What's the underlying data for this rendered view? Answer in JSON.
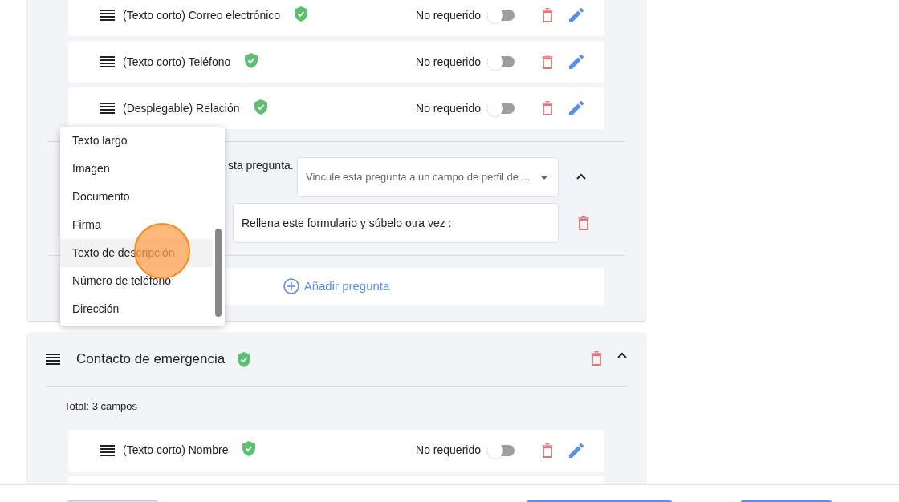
{
  "form_section": {
    "fields": [
      {
        "label": "(Texto corto) Correo electrónico",
        "verified": true,
        "required_label": "No requerido",
        "required": false
      },
      {
        "label": "(Texto corto) Teléfono",
        "verified": true,
        "required_label": "No requerido",
        "required": false
      },
      {
        "label": "(Desplegable) Relación",
        "verified": true,
        "required_label": "No requerido",
        "required": false
      }
    ],
    "question": {
      "label_fragment": "sta pregunta.",
      "link_select": {
        "placeholder": "Vincule esta pregunta a un campo de perfil de ..."
      },
      "expanded": true,
      "description": {
        "value": "Rellena este formulario y súbelo otra vez :"
      }
    },
    "add_button": "Añadir pregunta"
  },
  "type_menu": {
    "items": [
      {
        "label": "Texto largo",
        "selected": false
      },
      {
        "label": "Imagen",
        "selected": false
      },
      {
        "label": "Documento",
        "selected": false
      },
      {
        "label": "Firma",
        "selected": false
      },
      {
        "label": "Texto de descripción",
        "selected": true
      },
      {
        "label": "Número de teléfono",
        "selected": false
      },
      {
        "label": "Dirección",
        "selected": false
      }
    ]
  },
  "section": {
    "title": "Contacto de emergencia",
    "verified": true,
    "expanded": true,
    "total": "Total: 3 campos",
    "fields": [
      {
        "label": "(Texto corto) Nombre",
        "verified": true,
        "required_label": "No requerido",
        "required": false
      }
    ]
  }
}
